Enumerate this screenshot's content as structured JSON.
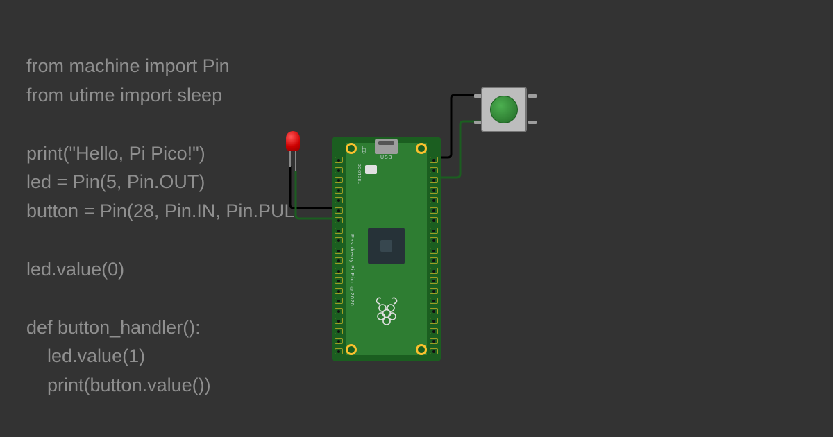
{
  "code": {
    "lines": [
      "from machine import Pin",
      "from utime import sleep",
      "",
      "print(\"Hello, Pi Pico!\")",
      "led = Pin(5, Pin.OUT)",
      "button = Pin(28, Pin.IN, Pin.PUL",
      "",
      "led.value(0)",
      "",
      "def button_handler():",
      "    led.value(1)",
      "    print(button.value())"
    ]
  },
  "board": {
    "name": "Raspberry Pi Pico",
    "text": "Raspberry Pi Pico ©2020",
    "usb_label": "USB",
    "led_label": "LED",
    "bootsel_label": "BOOTSEL"
  },
  "components": {
    "led": {
      "color": "#cc0000",
      "pin": 5
    },
    "button": {
      "color": "#2e7d32",
      "pin": 28
    }
  },
  "wires": [
    {
      "from": "led-cathode",
      "to": "pico-gnd-left",
      "color": "#000000"
    },
    {
      "from": "led-anode",
      "to": "pico-gp5",
      "color": "#1b5e20"
    },
    {
      "from": "button-1",
      "to": "pico-gnd-right",
      "color": "#000000"
    },
    {
      "from": "button-2",
      "to": "pico-gp28",
      "color": "#1b5e20"
    }
  ],
  "colors": {
    "background": "#333333",
    "code_text": "#8f8f8f",
    "board_green": "#2e7d32",
    "board_dark": "#1b5e20",
    "mount_yellow": "#fbc02d"
  }
}
